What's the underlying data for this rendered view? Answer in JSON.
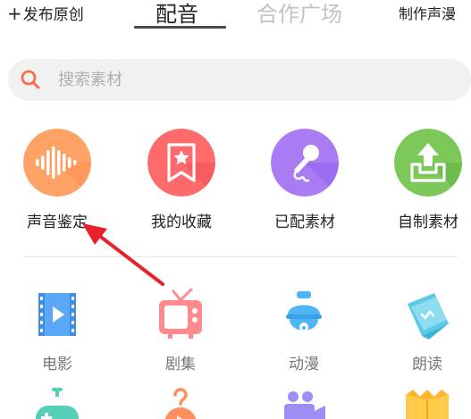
{
  "header": {
    "publish_plus": "+",
    "publish_label": "发布原创",
    "tabs": [
      {
        "label": "配音",
        "active": true
      },
      {
        "label": "合作广场",
        "active": false
      }
    ],
    "make_voice_label": "制作声漫"
  },
  "search": {
    "placeholder": "搜索素材",
    "icon": "search-icon"
  },
  "features": [
    {
      "label": "声音鉴定",
      "icon": "soundwave-icon",
      "color": "#ffa265"
    },
    {
      "label": "我的收藏",
      "icon": "bookmark-star-icon",
      "color": "#ff6b6b"
    },
    {
      "label": "已配素材",
      "icon": "microphone-icon",
      "color": "#a97cf4"
    },
    {
      "label": "自制素材",
      "icon": "upload-tray-icon",
      "color": "#7cc95a"
    }
  ],
  "categories": [
    {
      "label": "电影",
      "icon": "film-icon",
      "color": "#5aa8f5"
    },
    {
      "label": "剧集",
      "icon": "tv-icon",
      "color": "#ff8a8f"
    },
    {
      "label": "动漫",
      "icon": "bell-mascot-icon",
      "color": "#4fb6f5"
    },
    {
      "label": "朗读",
      "icon": "paper-icon",
      "color": "#5cc9e8"
    }
  ],
  "categories_row2": [
    {
      "icon": "game-controller-icon",
      "color": "#56d0b8"
    },
    {
      "icon": "hanger-icon",
      "color": "#ff8f5a"
    },
    {
      "icon": "camera-icon",
      "color": "#9e8df5"
    },
    {
      "icon": "book-icon",
      "color": "#ffc94a"
    }
  ],
  "annotation": {
    "color": "#e8202a"
  }
}
